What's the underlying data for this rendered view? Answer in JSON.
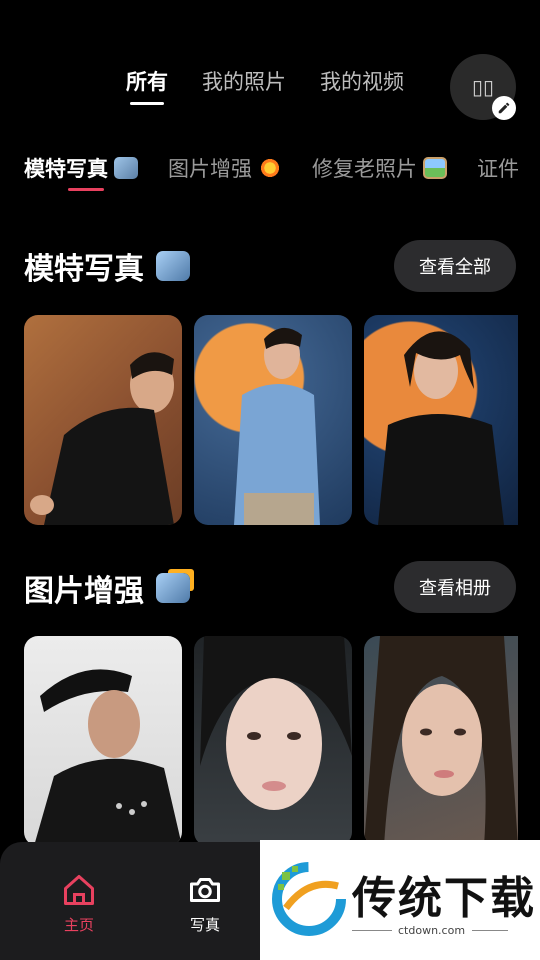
{
  "top_tabs": [
    "所有",
    "我的照片",
    "我的视频"
  ],
  "avatar_text": "▯▯",
  "categories": [
    "模特写真",
    "图片增强",
    "修复老照片",
    "证件"
  ],
  "sections": [
    {
      "title": "模特写真",
      "button": "查看全部"
    },
    {
      "title": "图片增强",
      "button": "查看相册"
    }
  ],
  "bottom_nav": {
    "home": "主页",
    "photo": "写真"
  },
  "banner": {
    "title": "传统下载",
    "url": "ctdown.com"
  },
  "colors": {
    "accent": "#e8415f",
    "background": "#000000",
    "pill": "#2c2c2e"
  }
}
